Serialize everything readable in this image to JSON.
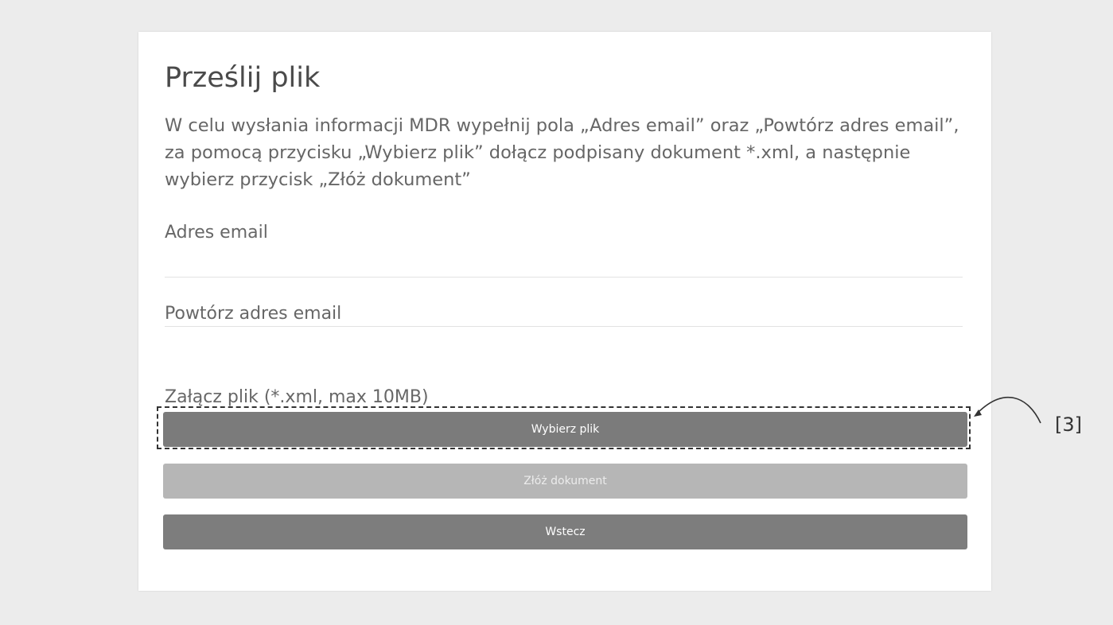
{
  "form": {
    "title": "Prześlij plik",
    "description": "W celu wysłania informacji MDR wypełnij pola „Adres email” oraz „Powtórz adres email”, za pomocą przycisku „Wybierz plik” dołącz podpisany dokument *.xml, a następnie wybierz przycisk „Złóż dokument”",
    "email_label": "Adres email",
    "email_value": "",
    "repeat_email_label": "Powtórz adres email",
    "repeat_email_value": "",
    "attach_label": "Załącz plik (*.xml, max 10MB)",
    "choose_file_label": "Wybierz plik",
    "submit_label": "Złóż dokument",
    "back_label": "Wstecz"
  },
  "annotation": {
    "marker": "[3]"
  }
}
